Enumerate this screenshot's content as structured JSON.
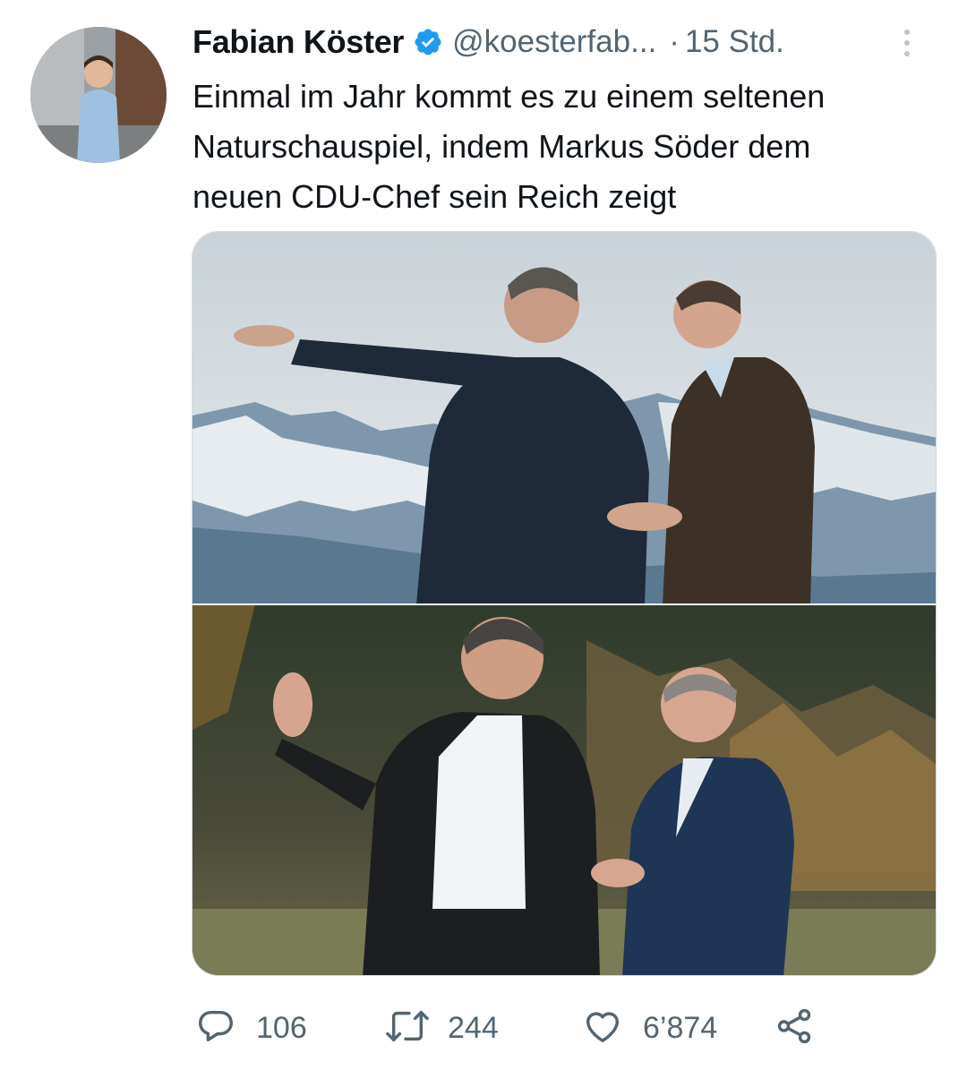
{
  "tweet": {
    "author": {
      "display_name": "Fabian Köster",
      "handle": "@koesterfab...",
      "verified": true
    },
    "separator": "·",
    "time": "15 Std.",
    "text": "Einmal im Jahr kommt es zu einem seltenen\nNaturschauspiel, indem Markus Söder dem\nneuen CDU-Chef sein Reich zeigt",
    "media": {
      "icons": {
        "top_photo": "mountain-photo",
        "bottom_photo": "forest-photo"
      }
    },
    "actions": {
      "replies": "106",
      "retweets": "244",
      "likes": "6’874"
    }
  },
  "colors": {
    "verified": "#1d9bf0",
    "muted": "#536471",
    "text": "#0f1419"
  },
  "icons": {
    "more": "more-vertical-icon",
    "reply": "reply-icon",
    "retweet": "retweet-icon",
    "like": "heart-icon",
    "share": "share-icon"
  }
}
